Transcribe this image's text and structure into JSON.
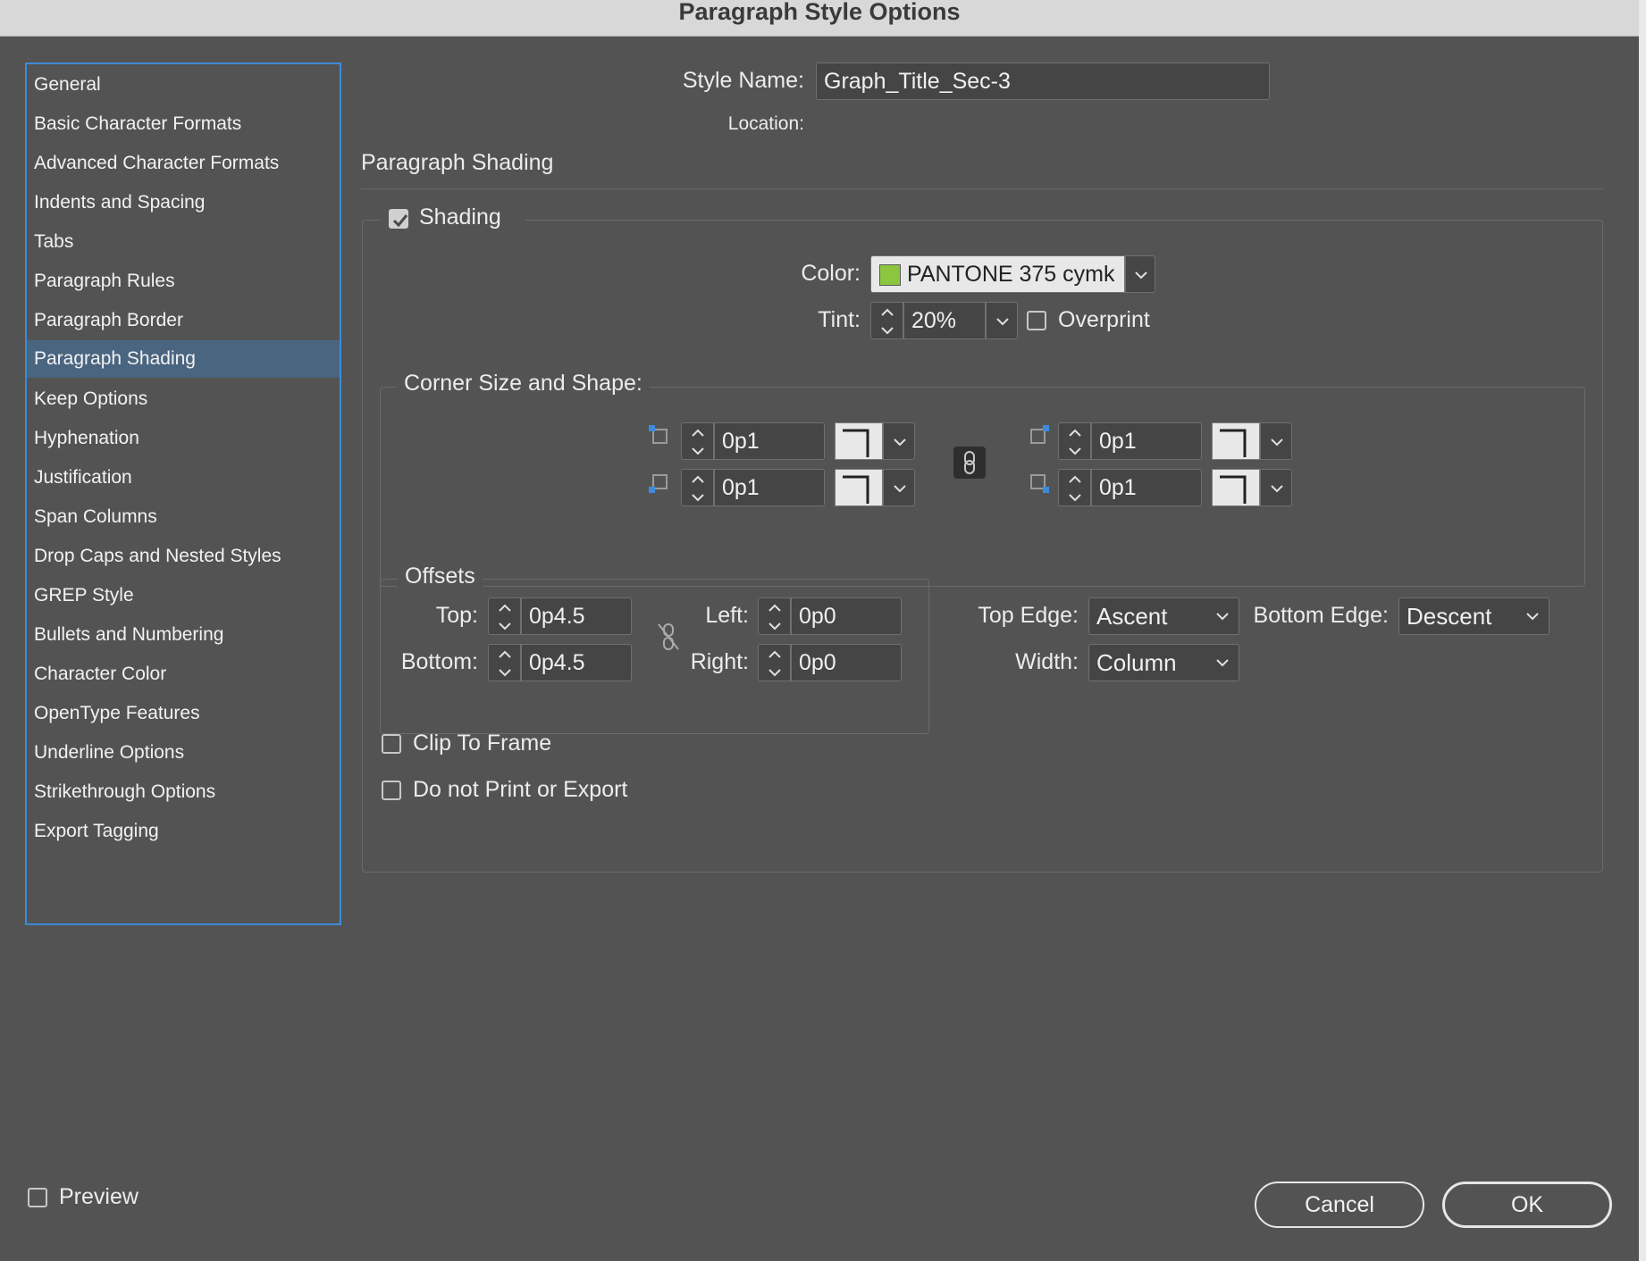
{
  "window": {
    "title": "Paragraph Style Options"
  },
  "sidebar": {
    "items": [
      {
        "label": "General"
      },
      {
        "label": "Basic Character Formats"
      },
      {
        "label": "Advanced Character Formats"
      },
      {
        "label": "Indents and Spacing"
      },
      {
        "label": "Tabs"
      },
      {
        "label": "Paragraph Rules"
      },
      {
        "label": "Paragraph Border"
      },
      {
        "label": "Paragraph Shading",
        "selected": true
      },
      {
        "label": "Keep Options"
      },
      {
        "label": "Hyphenation"
      },
      {
        "label": "Justification"
      },
      {
        "label": "Span Columns"
      },
      {
        "label": "Drop Caps and Nested Styles"
      },
      {
        "label": "GREP Style"
      },
      {
        "label": "Bullets and Numbering"
      },
      {
        "label": "Character Color"
      },
      {
        "label": "OpenType Features"
      },
      {
        "label": "Underline Options"
      },
      {
        "label": "Strikethrough Options"
      },
      {
        "label": "Export Tagging"
      }
    ]
  },
  "header": {
    "style_name_label": "Style Name:",
    "style_name_value": "Graph_Title_Sec-3",
    "location_label": "Location:"
  },
  "section": {
    "title": "Paragraph Shading"
  },
  "shading": {
    "checkbox_label": "Shading",
    "checked": true,
    "color_label": "Color:",
    "color_value": "PANTONE 375 cymk",
    "color_swatch": "#8cc63f",
    "tint_label": "Tint:",
    "tint_value": "20%",
    "overprint_label": "Overprint",
    "overprint_checked": false
  },
  "corners": {
    "legend": "Corner Size and Shape:",
    "top_left": "0p1",
    "bottom_left": "0p1",
    "top_right": "0p1",
    "bottom_right": "0p1"
  },
  "offsets": {
    "legend": "Offsets",
    "top_label": "Top:",
    "top_value": "0p4.5",
    "bottom_label": "Bottom:",
    "bottom_value": "0p4.5",
    "left_label": "Left:",
    "left_value": "0p0",
    "right_label": "Right:",
    "right_value": "0p0"
  },
  "edges": {
    "top_edge_label": "Top Edge:",
    "top_edge_value": "Ascent",
    "bottom_edge_label": "Bottom Edge:",
    "bottom_edge_value": "Descent",
    "width_label": "Width:",
    "width_value": "Column"
  },
  "options": {
    "clip_label": "Clip To Frame",
    "clip_checked": false,
    "noprint_label": "Do not Print or Export",
    "noprint_checked": false
  },
  "footer": {
    "preview_label": "Preview",
    "preview_checked": false,
    "cancel_label": "Cancel",
    "ok_label": "OK"
  },
  "colors": {
    "accent": "#3d8bd9",
    "selected_row": "#4a6580",
    "dialog_bg": "#535353"
  }
}
